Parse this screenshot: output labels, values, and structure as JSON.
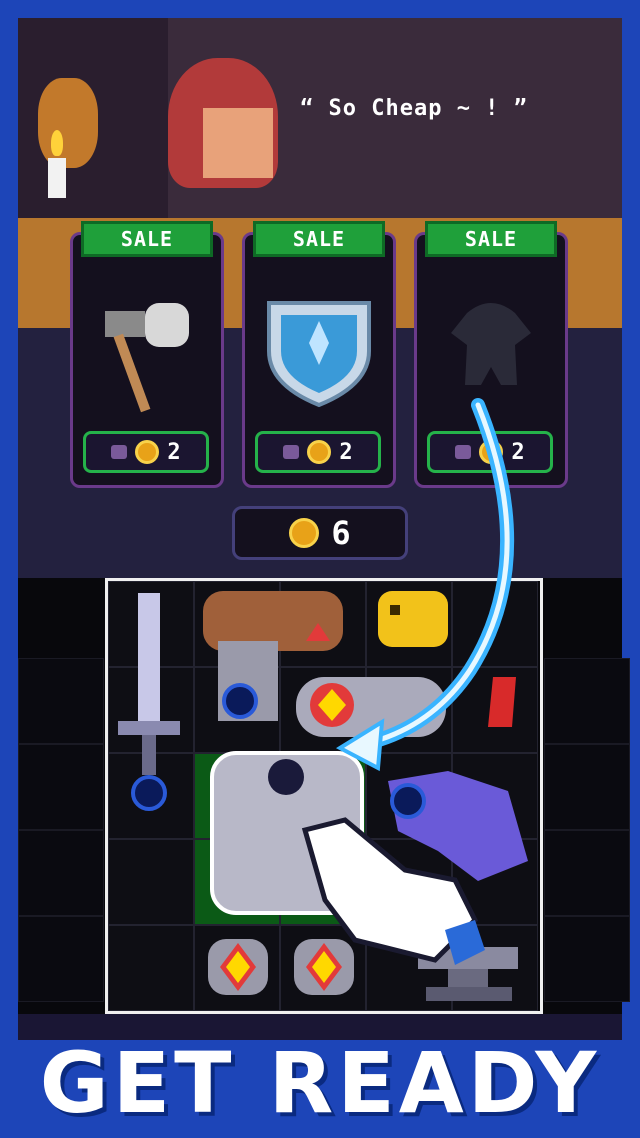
{
  "speech_bubble": "“ So Cheap ~ ! ”",
  "shop_cards": [
    {
      "badge": "SALE",
      "item_icon": "axe-icon",
      "price": "2"
    },
    {
      "badge": "SALE",
      "item_icon": "shield-icon",
      "price": "2"
    },
    {
      "badge": "SALE",
      "item_icon": "unknown-silhouette-icon",
      "price": "2"
    }
  ],
  "total_gold": "6",
  "inventory_items": [
    "sword-icon",
    "goblin-helmet-icon",
    "gold-pig-icon",
    "gauntlet-icon",
    "armor-icon",
    "dragon-icon",
    "ring-icon",
    "gem-icon",
    "anvil-icon"
  ],
  "banner_text": "GET READY",
  "colors": {
    "frame": "#1d45b8",
    "sale_green": "#1fa03a",
    "coin": "#e8a218",
    "arrow": "#3ab4ff"
  }
}
